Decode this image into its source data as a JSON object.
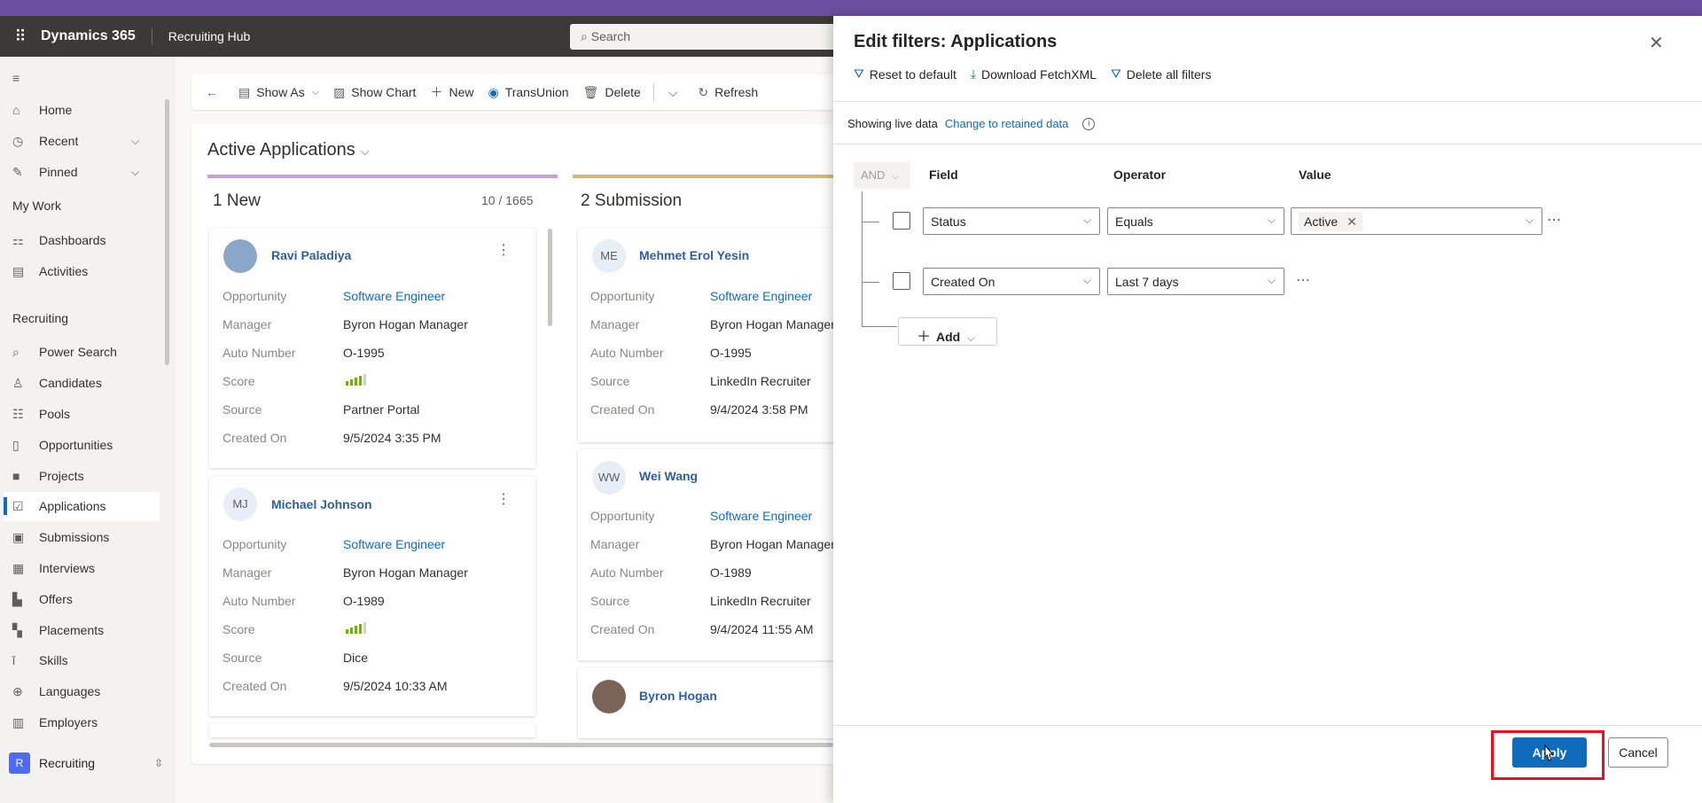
{
  "nav": {
    "app_name": "Dynamics 365",
    "hub_name": "Recruiting Hub",
    "search_placeholder": "Search"
  },
  "sidebar": {
    "home": "Home",
    "recent": "Recent",
    "pinned": "Pinned",
    "group_my_work": "My Work",
    "dashboards": "Dashboards",
    "activities": "Activities",
    "group_recruiting": "Recruiting",
    "items": [
      "Power Search",
      "Candidates",
      "Pools",
      "Opportunities",
      "Projects",
      "Applications",
      "Submissions",
      "Interviews",
      "Offers",
      "Placements",
      "Skills",
      "Languages",
      "Employers"
    ],
    "area_badge": "R",
    "area_name": "Recruiting"
  },
  "toolbar": {
    "show_as": "Show As",
    "show_chart": "Show Chart",
    "new": "New",
    "transunion": "TransUnion",
    "delete": "Delete",
    "refresh": "Refresh"
  },
  "board": {
    "view_title": "Active Applications",
    "col1": {
      "title": "1 New",
      "count": "10 / 1665"
    },
    "col2": {
      "title": "2 Submission"
    },
    "labels": {
      "opportunity": "Opportunity",
      "manager": "Manager",
      "auto_number": "Auto Number",
      "score": "Score",
      "source": "Source",
      "created_on": "Created On"
    },
    "cards": [
      {
        "name": "Ravi Paladiya",
        "opportunity": "Software Engineer",
        "manager": "Byron Hogan Manager",
        "auto_number": "O-1995",
        "score_level": 4,
        "source": "Partner Portal",
        "created_on": "9/5/2024 3:35 PM"
      },
      {
        "name": "Michael Johnson",
        "initials": "MJ",
        "opportunity": "Software Engineer",
        "manager": "Byron Hogan Manager",
        "auto_number": "O-1989",
        "score_level": 4,
        "source": "Dice",
        "created_on": "9/5/2024 10:33 AM"
      },
      {
        "name": "Mehmet Erol Yesin",
        "initials": "ME",
        "opportunity": "Software Engineer",
        "manager": "Byron Hogan Manager",
        "auto_number": "O-1995",
        "source": "LinkedIn Recruiter",
        "created_on": "9/4/2024 3:58 PM"
      },
      {
        "name": "Wei Wang",
        "initials": "WW",
        "opportunity": "Software Engineer",
        "manager": "Byron Hogan Manager",
        "auto_number": "O-1989",
        "source": "LinkedIn Recruiter",
        "created_on": "9/4/2024 11:55 AM"
      },
      {
        "name": "Byron Hogan"
      }
    ]
  },
  "panel": {
    "title": "Edit filters: Applications",
    "reset": "Reset to default",
    "download": "Download FetchXML",
    "delete_all": "Delete all filters",
    "live_text": "Showing live data",
    "change_link": "Change to retained data",
    "and_label": "AND",
    "headers": {
      "field": "Field",
      "operator": "Operator",
      "value": "Value"
    },
    "rows": [
      {
        "field": "Status",
        "operator": "Equals",
        "value_tag": "Active"
      },
      {
        "field": "Created On",
        "operator": "Last 7 days"
      }
    ],
    "add_label": "Add",
    "apply_label": "Apply",
    "cancel_label": "Cancel"
  },
  "colors": {
    "accent": "#0f6cbd",
    "navbar": "#3b3a39",
    "highlight": "#e81123"
  }
}
